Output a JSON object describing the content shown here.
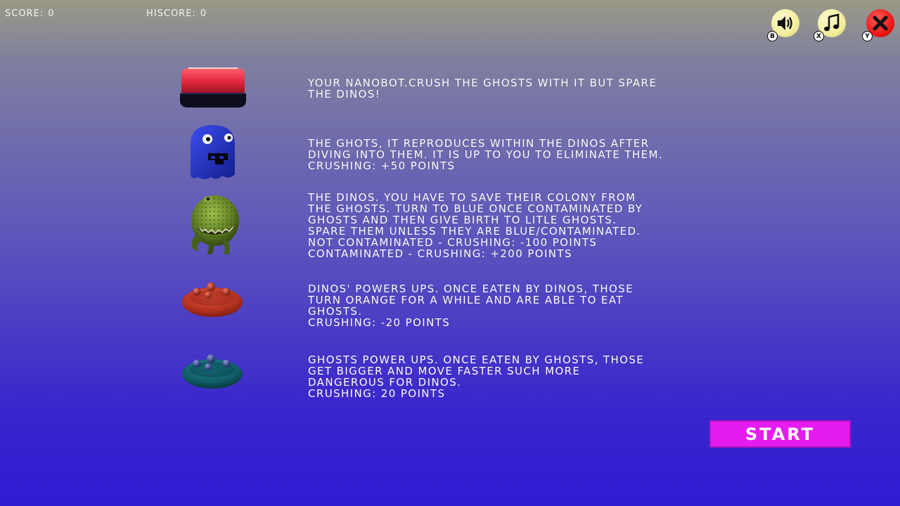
{
  "hud": {
    "score_label": "SCORE:",
    "score_value": "0",
    "hiscore_label": "HISCORE:",
    "hiscore_value": "0"
  },
  "controls": {
    "sound_icon": "speaker-icon",
    "sound_key": "B",
    "music_icon": "music-note-icon",
    "music_key": "X",
    "close_icon": "close-icon",
    "close_key": "Y"
  },
  "rows": [
    {
      "icon": "nanobot-icon",
      "text": "YOUR NANOBOT.CRUSH THE GHOSTS WITH IT BUT SPARE\nTHE DINOS!"
    },
    {
      "icon": "ghost-icon",
      "text": "THE GHOTS, IT REPRODUCES WITHIN THE DINOS AFTER\nDIVING INTO THEM. IT IS UP TO YOU TO ELIMINATE THEM.\nCRUSHING: +50 POINTS"
    },
    {
      "icon": "dino-icon",
      "text": "THE DINOS. YOU HAVE TO SAVE THEIR COLONY FROM\nTHE GHOSTS. TURN TO BLUE ONCE CONTAMINATED BY\nGHOSTS AND THEN GIVE BIRTH TO LITLE GHOSTS.\nSPARE THEM UNLESS THEY ARE BLUE/CONTAMINATED.\nNOT CONTAMINATED - CRUSHING: -100 POINTS\nCONTAMINATED - CRUSHING: +200 POINTS"
    },
    {
      "icon": "dino-powerup-icon",
      "text": "DINOS' POWERS UPS. ONCE EATEN BY DINOS, THOSE\nTURN ORANGE FOR A WHILE AND ARE ABLE TO EAT\nGHOSTS.\nCRUSHING: -20 POINTS"
    },
    {
      "icon": "ghost-powerup-icon",
      "text": "GHOSTS POWER UPS. ONCE EATEN BY GHOSTS, THOSE\nGET BIGGER AND MOVE FASTER SUCH MORE\nDANGEROUS FOR DINOS.\nCRUSHING: 20 POINTS"
    }
  ],
  "start_label": "START",
  "colors": {
    "start_button": "#e51cf0",
    "nanobot_red": "#e32b3e",
    "ghost_blue": "#1f2fc8",
    "dino_green": "#6a8a2a",
    "dino_powerup": "#c0392b",
    "ghost_powerup": "#0f5c66"
  }
}
